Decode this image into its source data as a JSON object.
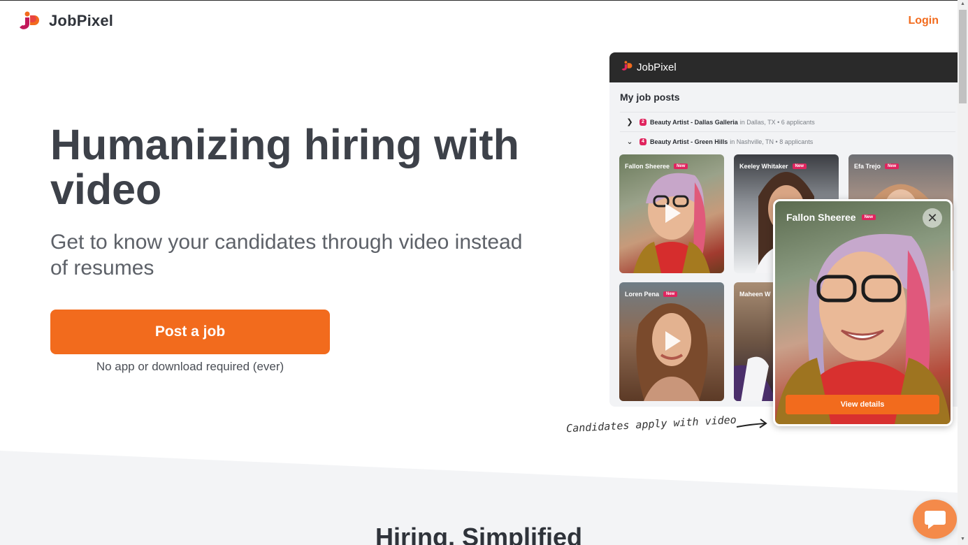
{
  "header": {
    "brand_name": "JobPixel",
    "login_label": "Login"
  },
  "hero": {
    "title": "Humanizing hiring with video",
    "subtitle": "Get to know your candidates through video instead of resumes",
    "cta_label": "Post a job",
    "cta_note": "No app or download required (ever)"
  },
  "mockup": {
    "brand_name": "JobPixel",
    "section_title": "My job posts",
    "jobs": [
      {
        "count": "2",
        "title": "Beauty Artist - Dallas Galleria",
        "location": "in Dallas, TX • 6 applicants",
        "expanded": false
      },
      {
        "count": "4",
        "title": "Beauty Artist - Green Hills",
        "location": "in Nashville, TN • 8 applicants",
        "expanded": true
      }
    ],
    "badge_label": "New",
    "candidates": [
      {
        "name": "Fallon Sheeree"
      },
      {
        "name": "Keeley Whitaker"
      },
      {
        "name": "Efa Trejo"
      },
      {
        "name": "Loren Pena"
      },
      {
        "name": "Maheen W"
      }
    ],
    "popup": {
      "name": "Fallon Sheeree",
      "badge": "New",
      "view_details_label": "View details"
    }
  },
  "annotation": "Candidates apply with video",
  "lower": {
    "title": "Hiring, Simplified"
  },
  "colors": {
    "accent": "#f26b1d",
    "badge": "#e0245e",
    "text_dark": "#3d4149",
    "mock_bar": "#2a2a2a"
  },
  "icons": {
    "logo": "jobpixel-logo-icon",
    "close": "close-icon",
    "play": "play-icon",
    "chat": "chat-icon",
    "chevron_right": "chevron-right-icon",
    "chevron_down": "chevron-down-icon"
  }
}
